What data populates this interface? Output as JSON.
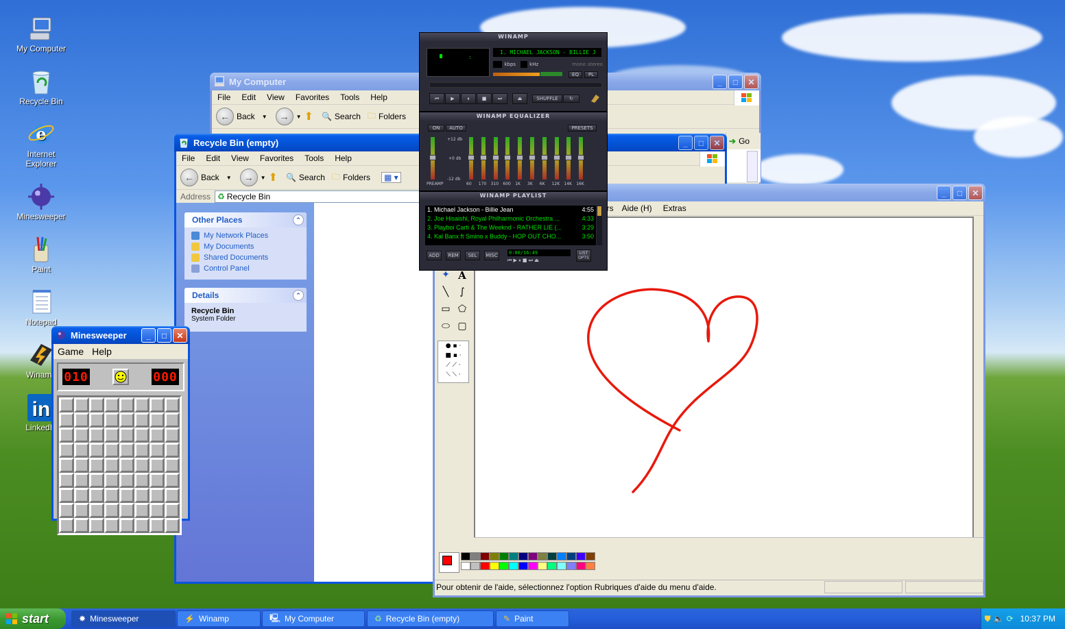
{
  "desktop_icons": [
    {
      "label": "My Computer",
      "icon": "my-computer-icon"
    },
    {
      "label": "Recycle Bin",
      "icon": "recycle-bin-icon"
    },
    {
      "label": "Internet Explorer",
      "icon": "internet-explorer-icon"
    },
    {
      "label": "Minesweeper",
      "icon": "minesweeper-icon"
    },
    {
      "label": "Paint",
      "icon": "paint-icon"
    },
    {
      "label": "Notepad",
      "icon": "notepad-icon"
    },
    {
      "label": "Winamp",
      "icon": "winamp-icon"
    },
    {
      "label": "LinkedIn",
      "icon": "linkedin-icon"
    }
  ],
  "my_computer": {
    "title": "My Computer",
    "menu": [
      "File",
      "Edit",
      "View",
      "Favorites",
      "Tools",
      "Help"
    ],
    "back_label": "Back",
    "search_label": "Search",
    "folders_label": "Folders",
    "go_label": "Go"
  },
  "recycle_bin": {
    "title": "Recycle Bin (empty)",
    "menu": [
      "File",
      "Edit",
      "View",
      "Favorites",
      "Tools",
      "Help"
    ],
    "back_label": "Back",
    "search_label": "Search",
    "folders_label": "Folders",
    "address_label": "Address",
    "address_value": "Recycle Bin",
    "other_places_title": "Other Places",
    "other_places": [
      "My Network Places",
      "My Documents",
      "Shared Documents",
      "Control Panel"
    ],
    "details_title": "Details",
    "details_name": "Recycle Bin",
    "details_type": "System Folder"
  },
  "minesweeper": {
    "title": "Minesweeper",
    "menu": [
      "Game",
      "Help"
    ],
    "mines_counter": "010",
    "timer": "000",
    "grid_rows": 9,
    "grid_cols": 8
  },
  "winamp": {
    "main_title": "WINAMP",
    "track_display": "1. MICHAEL JACKSON - BILLIE J",
    "kbps_label": "kbps",
    "khz_label": "kHz",
    "mono_label": "mono",
    "stereo_label": "stereo",
    "eq_btn": "EQ",
    "pl_btn": "PL",
    "shuffle_label": "SHUFFLE",
    "eq_title": "WINAMP EQUALIZER",
    "eq_on": "ON",
    "eq_auto": "AUTO",
    "eq_presets": "PRESETS",
    "eq_db_top": "+12 db",
    "eq_db_mid": "+0 db",
    "eq_db_bot": "-12 db",
    "eq_bands": [
      "PREAMP",
      "60",
      "170",
      "310",
      "600",
      "1K",
      "3K",
      "6K",
      "12K",
      "14K",
      "16K"
    ],
    "playlist_title": "WINAMP PLAYLIST",
    "playlist": [
      {
        "name": "1. Michael Jackson - Billie Jean",
        "time": "4:55"
      },
      {
        "name": "2. Joe Hisaishi, Royal Philharmonic Orchestra ...",
        "time": "4:33"
      },
      {
        "name": "3. Playboi Carti & The Weeknd - RATHER LIE (...",
        "time": "3:29"
      },
      {
        "name": "4. Kal Banx ft Smino x Buddy - HOP OUT CHO...",
        "time": "3:50"
      }
    ],
    "pl_buttons": [
      "ADD",
      "REM",
      "SEL",
      "MISC"
    ],
    "pl_time": "0:00/16:49",
    "list_opts": "LIST OPTS"
  },
  "paint": {
    "menu_partial": "urs",
    "menu": [
      "Aide (H)",
      "Extras"
    ],
    "status_text": "Pour obtenir de l'aide, sélectionnez l'option Rubriques d'aide du menu d'aide.",
    "palette_top": [
      "#000000",
      "#808080",
      "#800000",
      "#808000",
      "#008000",
      "#008080",
      "#000080",
      "#800080",
      "#808040",
      "#004040",
      "#0080ff",
      "#004080",
      "#4000ff",
      "#804000"
    ],
    "palette_bottom": [
      "#ffffff",
      "#c0c0c0",
      "#ff0000",
      "#ffff00",
      "#00ff00",
      "#00ffff",
      "#0000ff",
      "#ff00ff",
      "#ffff80",
      "#00ff80",
      "#80ffff",
      "#8080ff",
      "#ff0080",
      "#ff8040"
    ],
    "drawing_color": "#e8190c"
  },
  "taskbar": {
    "start_label": "start",
    "items": [
      "Minesweeper",
      "Winamp",
      "My Computer",
      "Recycle Bin (empty)",
      "Paint"
    ],
    "clock": "10:37 PM"
  }
}
